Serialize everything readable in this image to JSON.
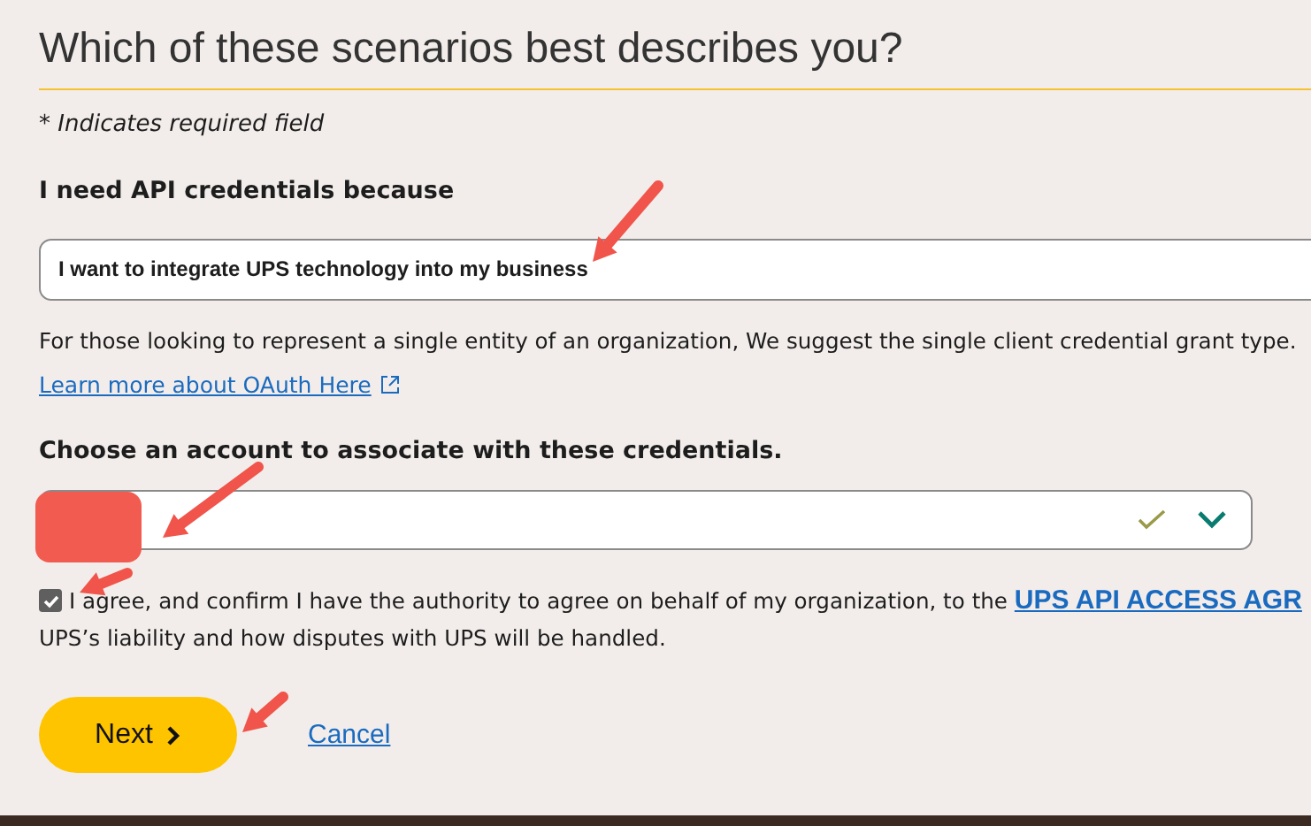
{
  "heading": "Which of these scenarios best describes you?",
  "required_note": "* Indicates required field",
  "reason": {
    "label": "I need API credentials because",
    "value": "I want to integrate UPS technology into my business"
  },
  "hint": "For those looking to represent a single entity of an organization, We suggest the single client credential grant type.",
  "oauth_link": "Learn more about OAuth Here",
  "account": {
    "label": "Choose an account to associate with these credentials.",
    "valid": true
  },
  "agreement": {
    "checked": true,
    "text": "I agree, and confirm I have the authority to agree on behalf of my organization, to the ",
    "link": "UPS API ACCESS AGR",
    "continuation": "UPS’s liability and how disputes with UPS will be handled."
  },
  "buttons": {
    "next": "Next",
    "cancel": "Cancel"
  }
}
